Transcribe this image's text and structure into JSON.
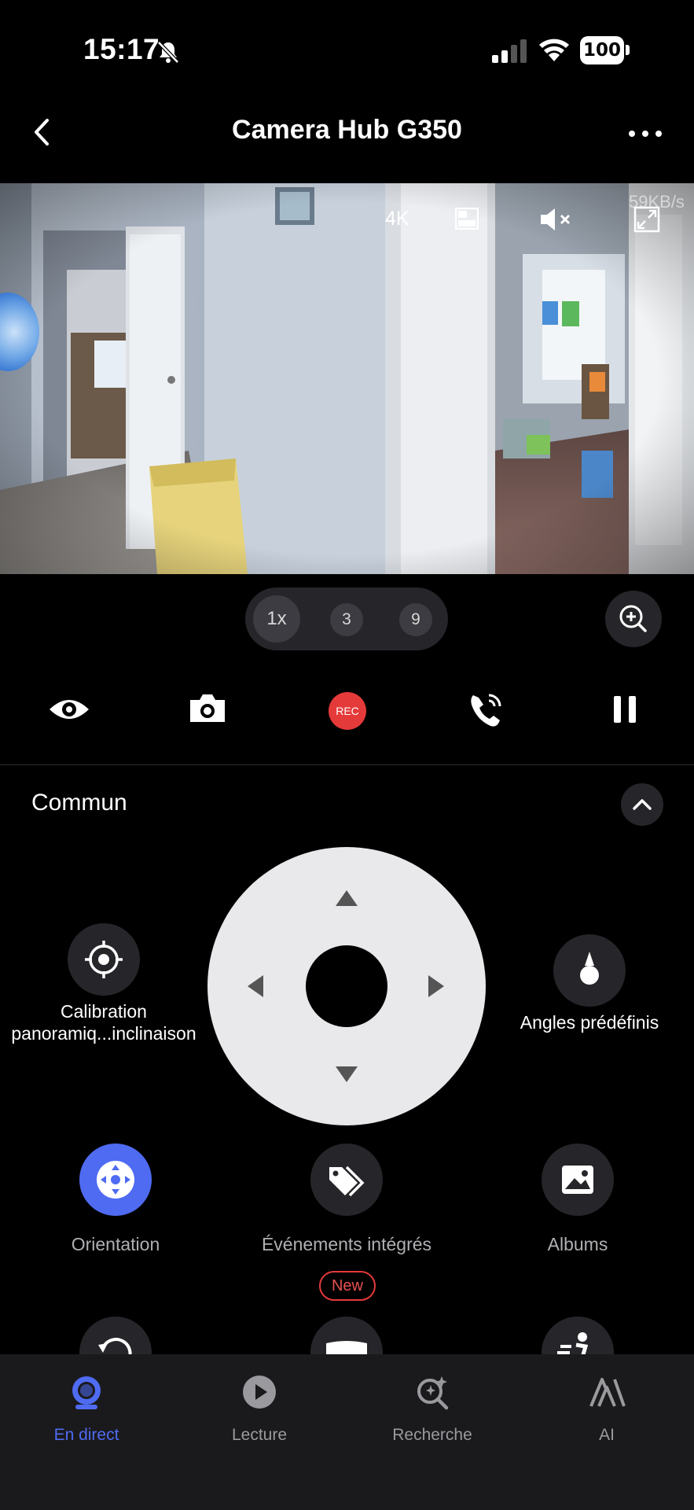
{
  "status_bar": {
    "time": "15:17",
    "battery": "100"
  },
  "nav": {
    "title": "Camera Hub G350"
  },
  "video": {
    "resolution": "4K",
    "bitrate": "59KB/s"
  },
  "zoom": {
    "options": [
      "1x",
      "3",
      "9"
    ],
    "selected": "1x"
  },
  "controls": {
    "record_label": "REC"
  },
  "section": {
    "title": "Commun"
  },
  "ptz": {
    "calibration_label": "Calibration panoramiq...inclinaison",
    "presets_label": "Angles prédéfinis"
  },
  "features": [
    {
      "label": "Orientation",
      "active": true
    },
    {
      "label": "Événements intégrés"
    },
    {
      "label": "Albums"
    }
  ],
  "badge": {
    "new": "New"
  },
  "tabs": [
    {
      "label": "En direct",
      "active": true
    },
    {
      "label": "Lecture"
    },
    {
      "label": "Recherche"
    },
    {
      "label": "AI"
    }
  ],
  "colors": {
    "accent": "#4f6bf2",
    "record": "#e53a3a",
    "surface": "#26262a"
  }
}
